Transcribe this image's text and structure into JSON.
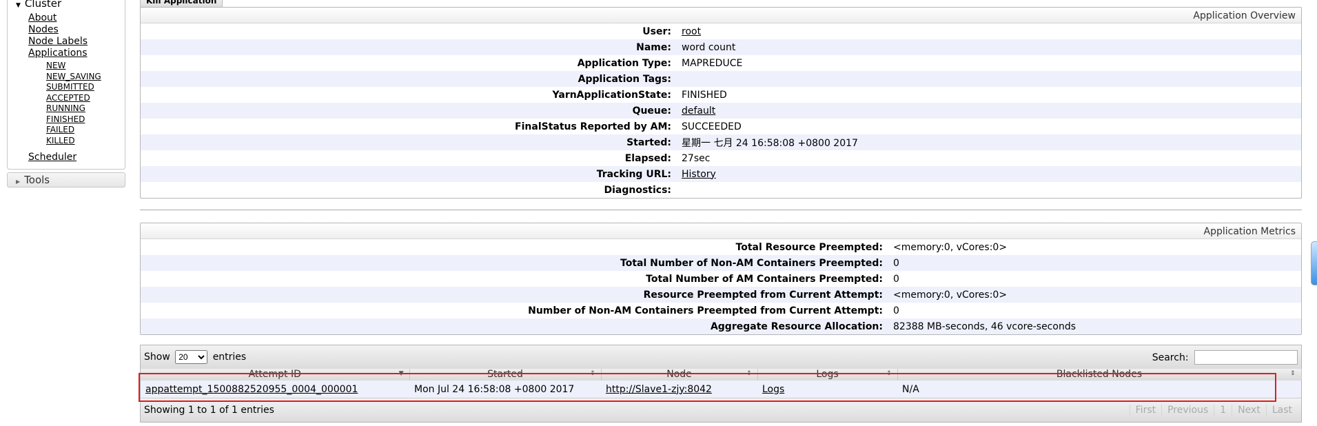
{
  "sidebar": {
    "cluster_label": "Cluster",
    "items": [
      {
        "label": "About"
      },
      {
        "label": "Nodes"
      },
      {
        "label": "Node Labels"
      },
      {
        "label": "Applications"
      }
    ],
    "app_states": [
      "NEW",
      "NEW_SAVING",
      "SUBMITTED",
      "ACCEPTED",
      "RUNNING",
      "FINISHED",
      "FAILED",
      "KILLED"
    ],
    "scheduler_label": "Scheduler",
    "tools_label": "Tools"
  },
  "kill_tab_label": "Kill Application",
  "overview": {
    "title": "Application Overview",
    "rows": [
      {
        "label": "User:",
        "value": "root",
        "link": true
      },
      {
        "label": "Name:",
        "value": "word count",
        "link": false
      },
      {
        "label": "Application Type:",
        "value": "MAPREDUCE",
        "link": false
      },
      {
        "label": "Application Tags:",
        "value": "",
        "link": false
      },
      {
        "label": "YarnApplicationState:",
        "value": "FINISHED",
        "link": false
      },
      {
        "label": "Queue:",
        "value": "default",
        "link": true
      },
      {
        "label": "FinalStatus Reported by AM:",
        "value": "SUCCEEDED",
        "link": false
      },
      {
        "label": "Started:",
        "value": "星期一 七月 24 16:58:08 +0800 2017",
        "link": false
      },
      {
        "label": "Elapsed:",
        "value": "27sec",
        "link": false
      },
      {
        "label": "Tracking URL:",
        "value": "History",
        "link": true
      },
      {
        "label": "Diagnostics:",
        "value": "",
        "link": false
      }
    ]
  },
  "metrics": {
    "title": "Application Metrics",
    "rows": [
      {
        "label": "Total Resource Preempted:",
        "value": "<memory:0, vCores:0>"
      },
      {
        "label": "Total Number of Non-AM Containers Preempted:",
        "value": "0"
      },
      {
        "label": "Total Number of AM Containers Preempted:",
        "value": "0"
      },
      {
        "label": "Resource Preempted from Current Attempt:",
        "value": "<memory:0, vCores:0>"
      },
      {
        "label": "Number of Non-AM Containers Preempted from Current Attempt:",
        "value": "0"
      },
      {
        "label": "Aggregate Resource Allocation:",
        "value": "82388 MB-seconds, 46 vcore-seconds"
      }
    ]
  },
  "attempts": {
    "show_label": "Show",
    "page_size": "20",
    "entries_label": "entries",
    "search_label": "Search:",
    "search_value": "",
    "columns": [
      "Attempt ID",
      "Started",
      "Node",
      "Logs",
      "Blacklisted Nodes"
    ],
    "rows": [
      {
        "attempt_id": "appattempt_1500882520955_0004_000001",
        "started": "Mon Jul 24 16:58:08 +0800 2017",
        "node": "http://Slave1-zjy:8042",
        "logs": "Logs",
        "blacklisted": "N/A"
      }
    ],
    "info": "Showing 1 to 1 of 1 entries",
    "pager": {
      "first": "First",
      "previous": "Previous",
      "page": "1",
      "next": "Next",
      "last": "Last"
    }
  }
}
